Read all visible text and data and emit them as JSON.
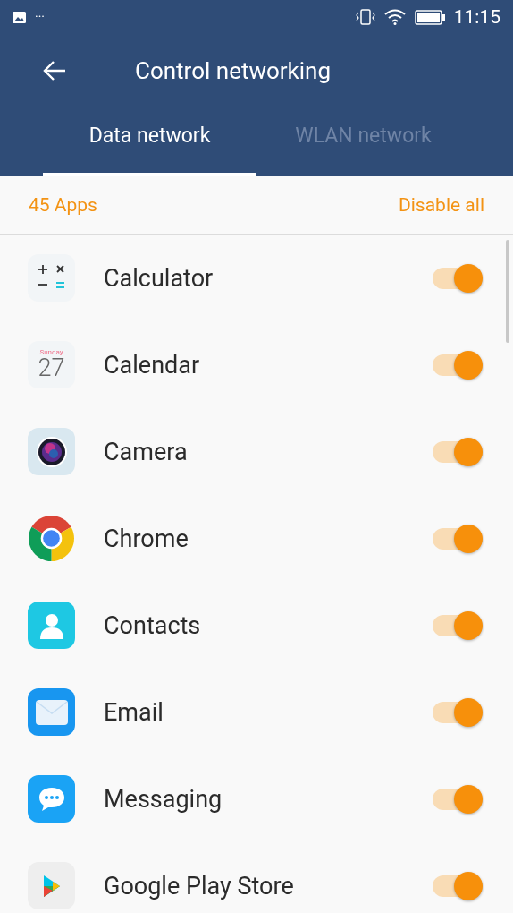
{
  "status_bar": {
    "notification_more": "···",
    "time": "11:15"
  },
  "app_bar": {
    "title": "Control networking"
  },
  "tabs": [
    {
      "label": "Data network",
      "selected": true
    },
    {
      "label": "WLAN network",
      "selected": false
    }
  ],
  "summary": {
    "count": "45 Apps",
    "action": "Disable all"
  },
  "apps": [
    {
      "name": "Calculator",
      "kind": "calculator",
      "on": true
    },
    {
      "name": "Calendar",
      "kind": "calendar",
      "icon_day": "Sunday",
      "icon_date": "27",
      "on": true
    },
    {
      "name": "Camera",
      "kind": "camera",
      "on": true
    },
    {
      "name": "Chrome",
      "kind": "chrome",
      "on": true
    },
    {
      "name": "Contacts",
      "kind": "contacts",
      "on": true
    },
    {
      "name": "Email",
      "kind": "email",
      "on": true
    },
    {
      "name": "Messaging",
      "kind": "messaging",
      "on": true
    },
    {
      "name": "Google Play Store",
      "kind": "store",
      "on": true
    }
  ]
}
